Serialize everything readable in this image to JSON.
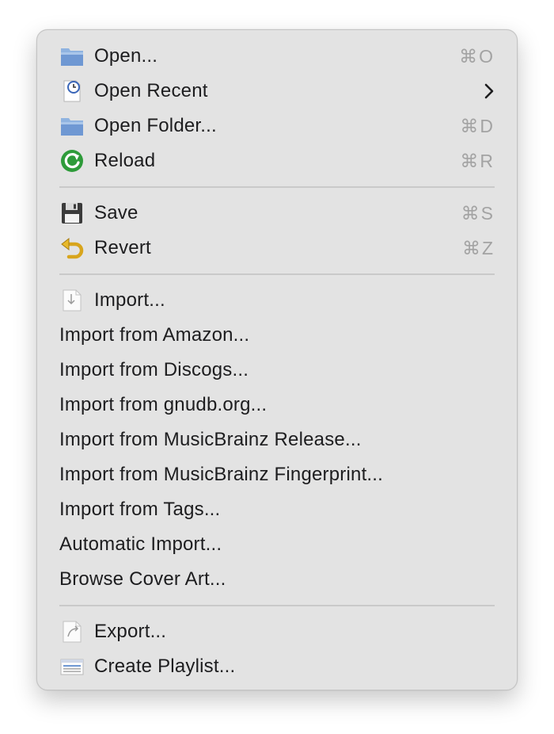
{
  "menu": {
    "group1": [
      {
        "label": "Open...",
        "shortcut": "⌘O",
        "icon": "folder-icon"
      },
      {
        "label": "Open Recent",
        "shortcut": "",
        "icon": "recent-document-clock-icon",
        "submenu": true
      },
      {
        "label": "Open Folder...",
        "shortcut": "⌘D",
        "icon": "folder-icon"
      },
      {
        "label": "Reload",
        "shortcut": "⌘R",
        "icon": "reload-icon"
      }
    ],
    "group2": [
      {
        "label": "Save",
        "shortcut": "⌘S",
        "icon": "floppy-disk-icon"
      },
      {
        "label": "Revert",
        "shortcut": "⌘Z",
        "icon": "revert-arrow-icon"
      }
    ],
    "group3": [
      {
        "label": "Import...",
        "icon": "import-document-icon"
      },
      {
        "label": "Import from Amazon..."
      },
      {
        "label": "Import from Discogs..."
      },
      {
        "label": "Import from gnudb.org..."
      },
      {
        "label": "Import from MusicBrainz Release..."
      },
      {
        "label": "Import from MusicBrainz Fingerprint..."
      },
      {
        "label": "Import from Tags..."
      },
      {
        "label": "Automatic Import..."
      },
      {
        "label": "Browse Cover Art..."
      }
    ],
    "group4": [
      {
        "label": "Export...",
        "icon": "export-document-icon"
      },
      {
        "label": "Create Playlist...",
        "icon": "playlist-icon"
      }
    ]
  },
  "colors": {
    "menu_bg": "#e3e3e3",
    "text": "#1d1d1f",
    "shortcut": "#a3a3a3",
    "separator": "#c9c9c9"
  }
}
